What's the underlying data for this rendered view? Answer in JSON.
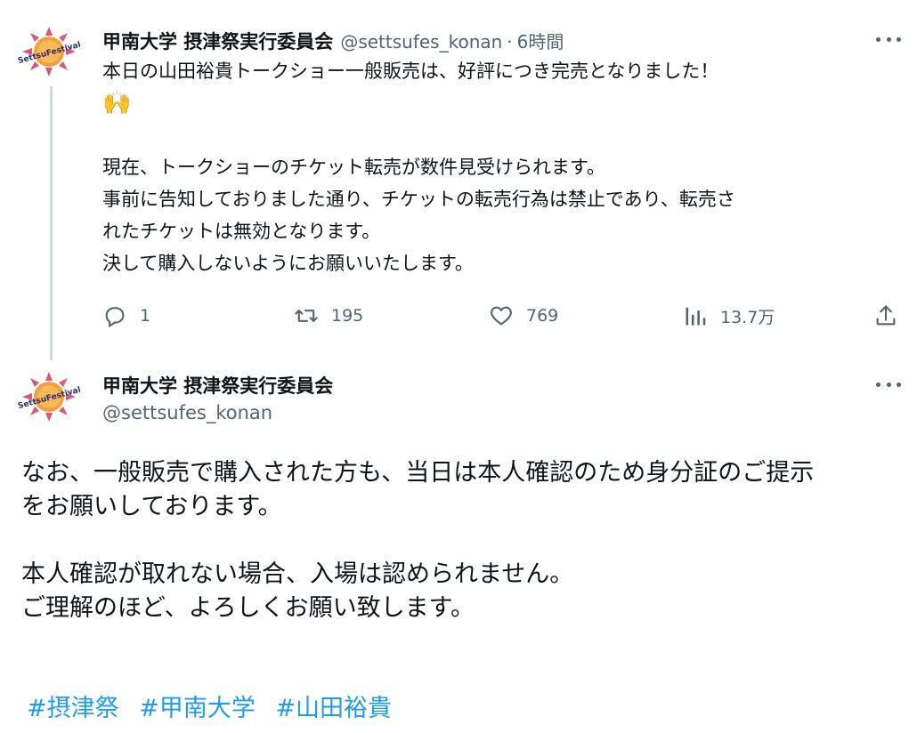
{
  "tweet1": {
    "name": "甲南大学 摂津祭実行委員会",
    "handle": "@settsufes_konan",
    "separator": "·",
    "time": "6時間",
    "avatar_text": "SettsuFestival",
    "lines": [
      "本日の山田裕貴トークショー一般販売は、好評につき完売となりました！",
      "🙌",
      "",
      "現在、トークショーのチケット転売が数件見受けられます。",
      "事前に告知しておりました通り、チケットの転売行為は禁止であり、転売さ",
      "れたチケットは無効となります。",
      "決して購入しないようにお願いいたします。"
    ],
    "actions": {
      "reply_icon": "reply-icon",
      "reply_count": "1",
      "retweet_icon": "retweet-icon",
      "retweet_count": "195",
      "like_icon": "heart-icon",
      "like_count": "769",
      "views_icon": "views-icon",
      "views_count": "13.7万",
      "share_icon": "share-icon"
    }
  },
  "tweet2": {
    "name": "甲南大学 摂津祭実行委員会",
    "handle": "@settsufes_konan",
    "avatar_text": "SettsuFestival",
    "lines": [
      "なお、一般販売で購入された方も、当日は本人確認のため身分証のご提示",
      "をお願いしております。",
      "",
      "本人確認が取れない場合、入場は認められません。",
      "ご理解のほど、よろしくお願い致します。"
    ],
    "hashtags": [
      "#摂津祭",
      "#甲南大学",
      "#山田裕貴"
    ]
  },
  "colors": {
    "text": "#0f1419",
    "secondary": "#536471",
    "link": "#1d9bf0",
    "thread_line": "#cfd9de",
    "avatar_sun": "#f5a03a",
    "avatar_rays": "#d9577a"
  }
}
